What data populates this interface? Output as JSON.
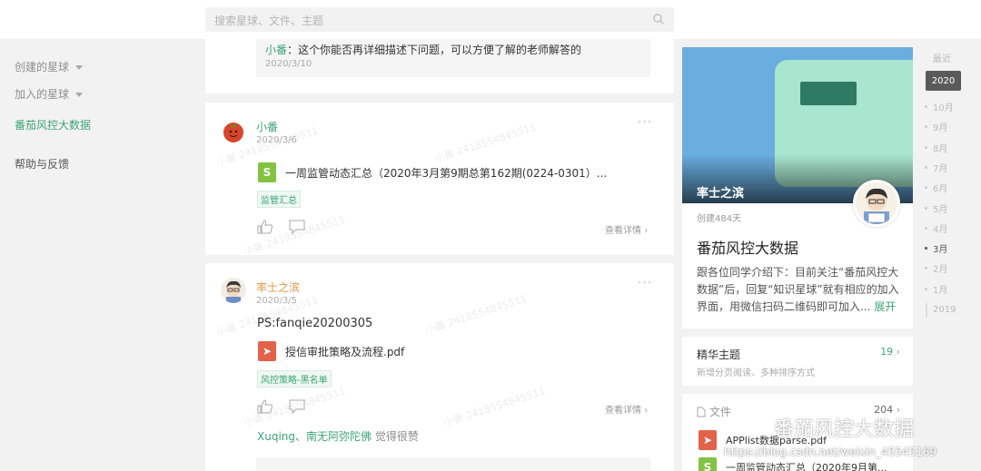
{
  "search": {
    "placeholder": "搜索星球、文件、主题"
  },
  "leftnav": {
    "created": "创建的星球",
    "joined": "加入的星球",
    "active_planet": "番茄风控大数据",
    "help": "帮助与反馈"
  },
  "comment": {
    "user": "小番",
    "text": "：这个你能否再详细描述下问题，可以方便了解的老师解答的",
    "date": "2020/3/10"
  },
  "post1": {
    "author": "小番",
    "date": "2020/3/6",
    "file_name": "一周监管动态汇总（2020年3月第9期总第162期(0224-0301）...",
    "tag": "监管汇总",
    "detail": "查看详情",
    "watermark": "小番 2418554845511"
  },
  "post2": {
    "author": "率士之滨",
    "date": "2020/3/5",
    "body": "PS:fanqie20200305",
    "file_name": "授信审批策略及流程.pdf",
    "tag": "风控策略-黑名单",
    "detail": "查看详情",
    "likers": "Xuqing、南无阿弥陀佛",
    "likers_suffix": " 觉得很赞",
    "watermark": "小番 2418554845511"
  },
  "planet": {
    "owner": "率士之滨",
    "created": "创建484天",
    "title": "番茄风控大数据",
    "intro": "跟各位同学介绍下：目前关注“番茄风控大数据”后，回复“知识星球”就有相应的加入界面，用微信扫码二维码即可加入...",
    "expand": "展开"
  },
  "essence": {
    "title": "精华主题",
    "count": "19",
    "sub": "新增分页阅读、多种排序方式"
  },
  "files": {
    "title": "文件",
    "count": "204",
    "item1": "APPlist数据parse.pdf",
    "item2": "一周监管动态汇总（2020年9月第..."
  },
  "timeline": {
    "latest": "最近",
    "year_current": "2020",
    "months": [
      "10月",
      "9月",
      "8月",
      "7月",
      "6月",
      "5月",
      "4月",
      "3月",
      "2月",
      "1月"
    ],
    "current_month": "3月",
    "year_prev": "2019"
  },
  "watermark_brand": "番茄风控大数据",
  "watermark_url": "https://blog.csdn.net/weixin_45545169"
}
